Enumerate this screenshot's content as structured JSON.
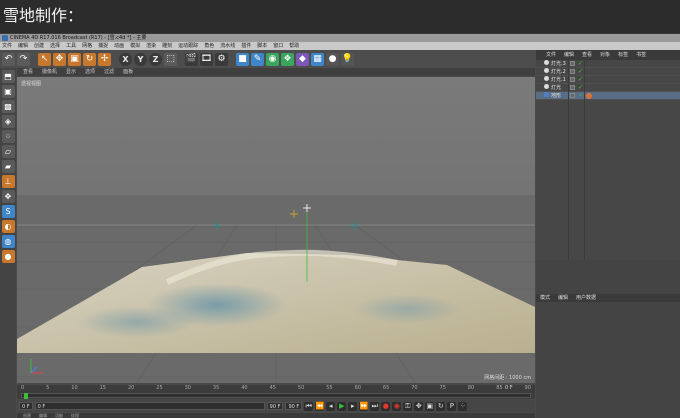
{
  "header": {
    "title": "雪地制作："
  },
  "window": {
    "title": "CINEMA 4D R17.016 Broadcast (R17) - [雪.c4d *] - 主要"
  },
  "menubar": {
    "items": [
      "文件",
      "编辑",
      "创建",
      "选择",
      "工具",
      "网格",
      "捕捉",
      "动画",
      "模拟",
      "渲染",
      "雕刻",
      "运动跟踪",
      "角色",
      "流水线",
      "插件",
      "脚本",
      "窗口",
      "帮助"
    ]
  },
  "toolbar": {
    "undo_icon": "undo-icon",
    "axis_x": "X",
    "axis_y": "Y",
    "axis_z": "Z"
  },
  "viewport": {
    "menu": [
      "查看",
      "摄像机",
      "显示",
      "选项",
      "过滤",
      "面板"
    ],
    "label": "透视视图",
    "scale": "网格间距 : 1000 cm"
  },
  "timeline": {
    "ticks": [
      "0",
      "5",
      "10",
      "15",
      "20",
      "25",
      "30",
      "35",
      "40",
      "45",
      "50",
      "55",
      "60",
      "65",
      "70",
      "75",
      "80",
      "85",
      "90"
    ],
    "frame": "0 F",
    "start": "0 F",
    "current": "0 F",
    "end": "90 F",
    "end2": "90 F"
  },
  "bottom_tabs": [
    "创建",
    "编辑",
    "功能",
    "纹理"
  ],
  "objects": {
    "tabs": [
      "文件",
      "编辑",
      "查看",
      "对象",
      "标签",
      "书签"
    ],
    "rows": [
      {
        "name": "灯光.3",
        "type": "light"
      },
      {
        "name": "灯光.2",
        "type": "light"
      },
      {
        "name": "灯光.1",
        "type": "light"
      },
      {
        "name": "灯光",
        "type": "light"
      },
      {
        "name": "地形",
        "type": "landscape"
      }
    ]
  },
  "attributes": {
    "tabs": [
      "模式",
      "编辑",
      "用户数据"
    ]
  },
  "colors": {
    "accent": "#3a6fb8",
    "play": "#35c23a",
    "record": "#e23a2a"
  }
}
